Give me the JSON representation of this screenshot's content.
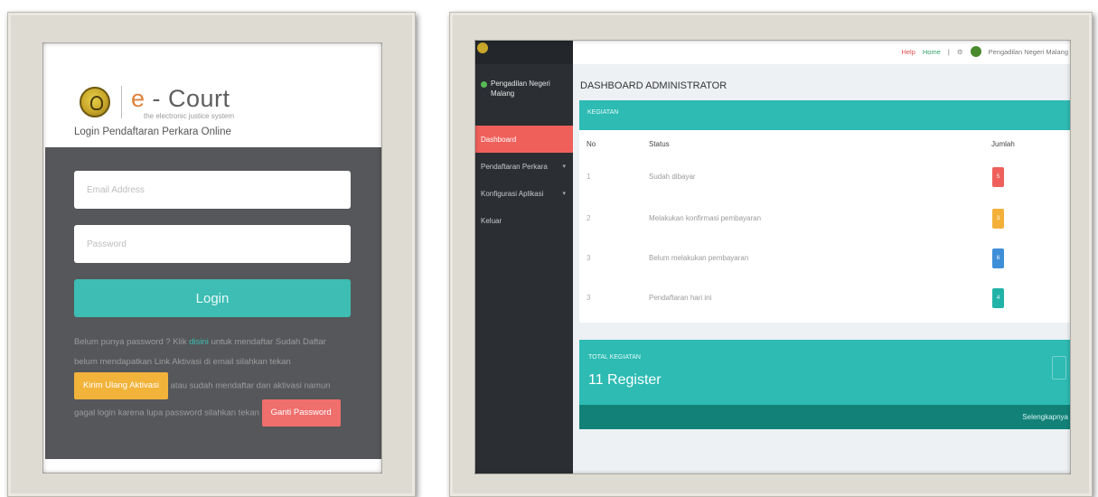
{
  "login": {
    "brand_e": "e",
    "brand_rest": " - Court",
    "brand_tagline": "the electronic justice system",
    "title": "Login Pendaftaran Perkara Online",
    "email_placeholder": "Email Address",
    "password_placeholder": "Password",
    "login_label": "Login",
    "help_text_1": "Belum punya password ? Klik",
    "help_link": "disini",
    "help_text_2": "untuk mendaftar Sudah Daftar belum mendapatkan Link Aktivasi di email silahkan tekan",
    "resend_label": "Kirim Ulang Aktivasi",
    "help_text_3": "atau sudah mendaftar dan aktivasi namun gagal login karena lupa password silahkan tekan",
    "reset_label": "Ganti Password"
  },
  "admin": {
    "sidebar_user": "Pengadilan Negeri Malang",
    "sidebar_items": [
      "Dashboard",
      "Pendaftaran Perkara",
      "Konfigurasi Aplikasi",
      "Keluar"
    ],
    "topbar": {
      "help": "Help",
      "home": "Home",
      "user": "Pengadilan Negeri Malang"
    },
    "page_title": "DASHBOARD ADMINISTRATOR",
    "card_title": "KEGIATAN",
    "columns": [
      "No",
      "Status",
      "Jumlah"
    ],
    "rows": [
      {
        "no": "1",
        "status": "Sudah dibayar",
        "count": "5",
        "color": "#ef5f5b"
      },
      {
        "no": "2",
        "status": "Melakukan konfirmasi pembayaran",
        "count": "3",
        "color": "#f3b13a"
      },
      {
        "no": "3",
        "status": "Belum melakukan pembayaran",
        "count": "6",
        "color": "#3e8fd8"
      },
      {
        "no": "3",
        "status": "Pendaftaran hari ini",
        "count": "4",
        "color": "#22b3a8"
      }
    ],
    "total_label": "TOTAL KEGIATAN",
    "total_value": "11 Register",
    "more_label": "Selengkapnya"
  }
}
